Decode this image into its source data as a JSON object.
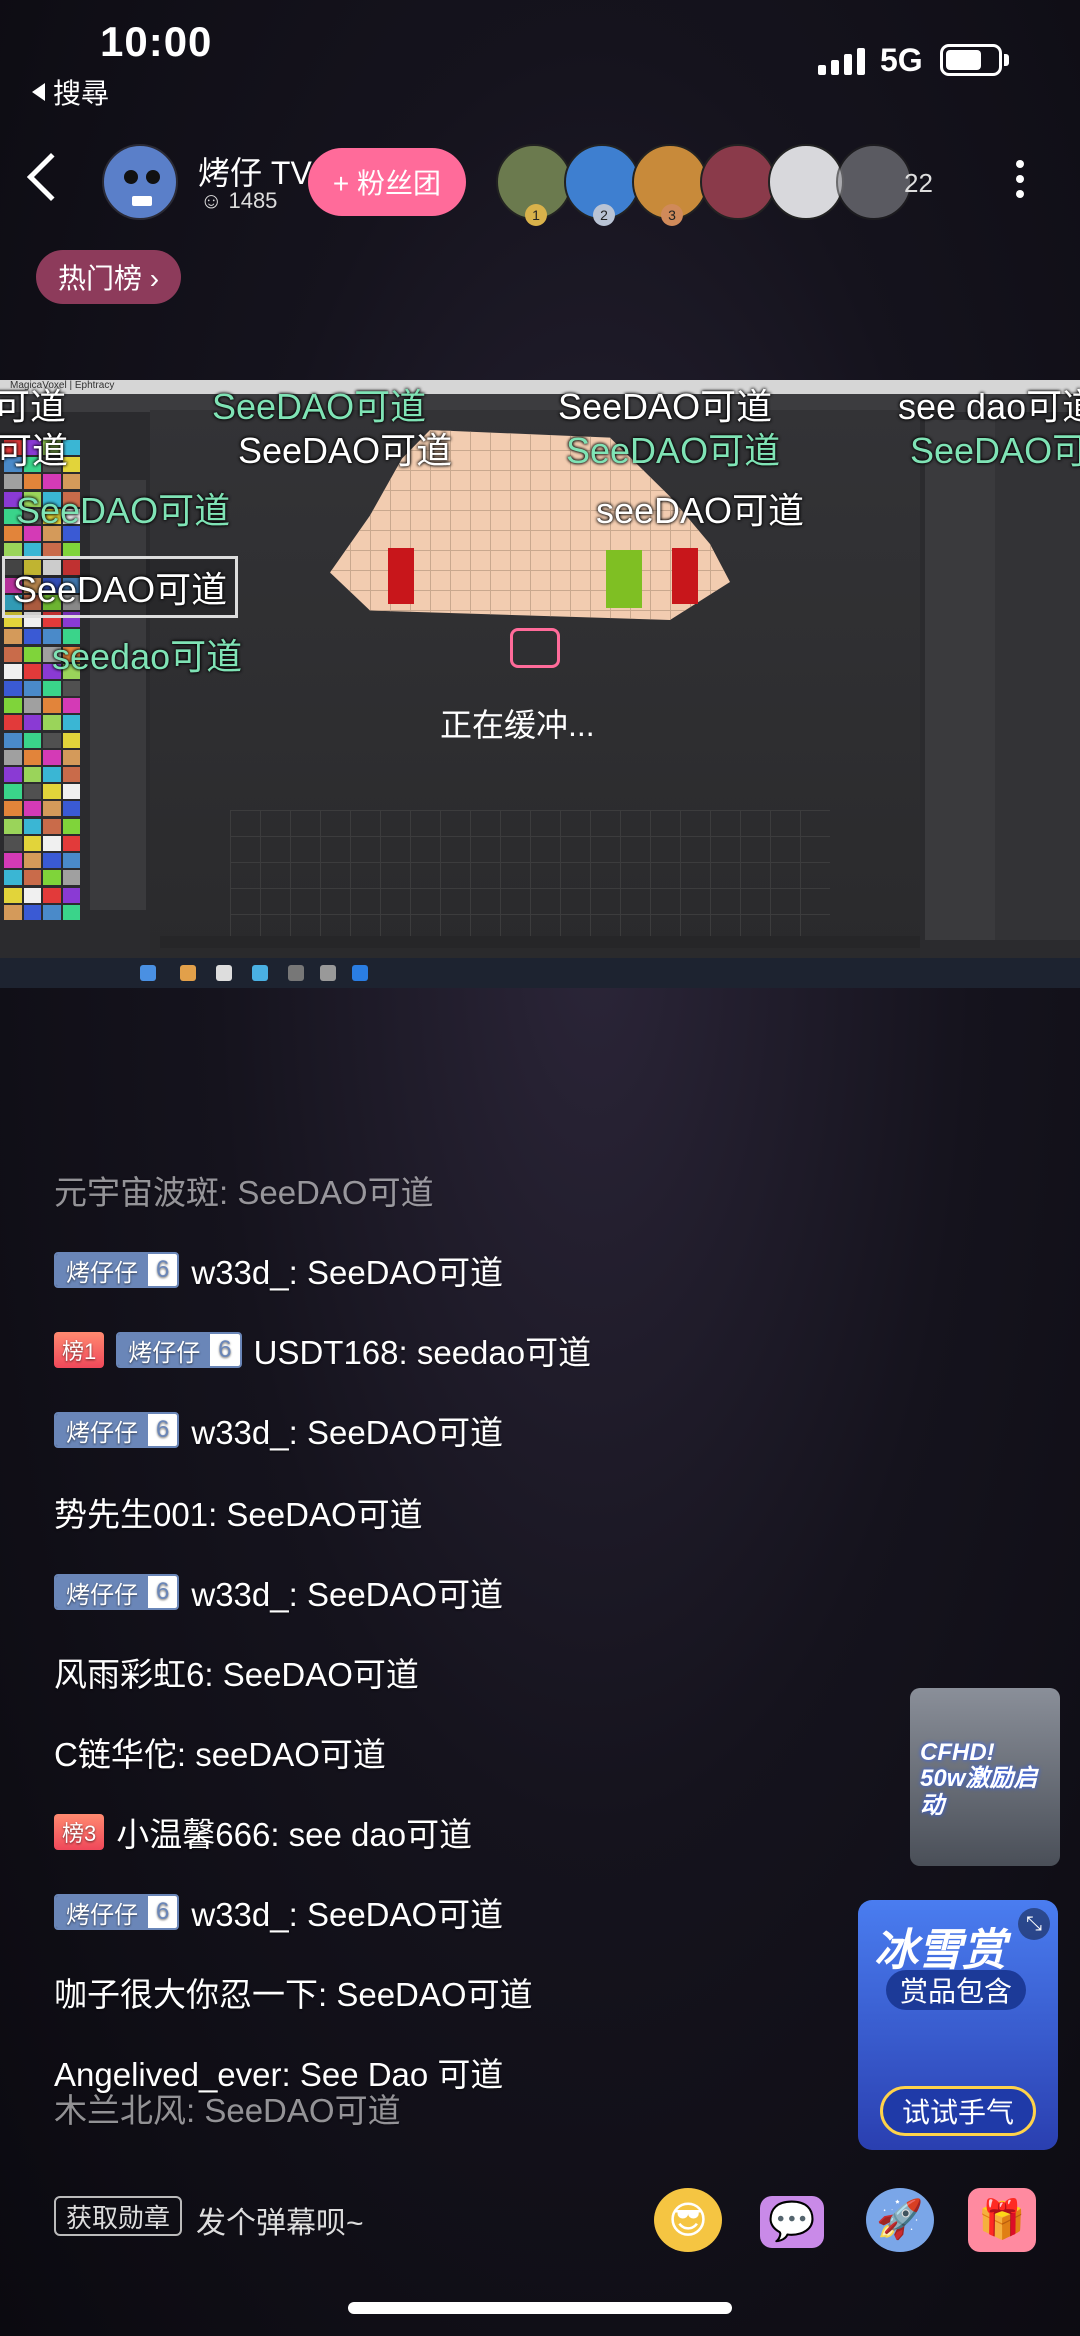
{
  "status_bar": {
    "time": "10:00",
    "back_app": "搜尋",
    "network": "5G"
  },
  "header": {
    "host_name": "烤仔 TV",
    "fan_count": "1485",
    "fan_club_label": "+ 粉丝团",
    "viewer_count": "22",
    "hot_tag": "热门榜 ›",
    "viewer_ranks": [
      "1",
      "2",
      "3"
    ]
  },
  "video": {
    "app_title": "MagicaVoxel | Ephtracy",
    "status": "正在缓冲...",
    "danmaku": [
      "可道",
      "SeeDAO可道",
      "SeeDAO可道",
      "see dao可道",
      "SeeDAO可道",
      "SeeDAO可道",
      "SeeDAO可",
      "可道",
      "SeeDAO可道",
      "seeDAO可道",
      "SeeDAO可道",
      "seedao可道"
    ]
  },
  "chat": [
    {
      "name": "元宇宙波斑",
      "message": "SeeDAO可道",
      "faded": true
    },
    {
      "medal": "烤仔仔",
      "level": "6",
      "name": "w33d_",
      "message": "SeeDAO可道"
    },
    {
      "rank": "榜1",
      "medal": "烤仔仔",
      "level": "6",
      "name": "USDT168",
      "message": "seedao可道"
    },
    {
      "medal": "烤仔仔",
      "level": "6",
      "name": "w33d_",
      "message": "SeeDAO可道"
    },
    {
      "name": "势先生001",
      "message": "SeeDAO可道"
    },
    {
      "medal": "烤仔仔",
      "level": "6",
      "name": "w33d_",
      "message": "SeeDAO可道"
    },
    {
      "name": "风雨彩虹6",
      "message": "SeeDAO可道"
    },
    {
      "name": "C链华佗",
      "message": "seeDAO可道"
    },
    {
      "rank": "榜3",
      "name": "小温馨666",
      "message": "see dao可道"
    },
    {
      "medal": "烤仔仔",
      "level": "6",
      "name": "w33d_",
      "message": "SeeDAO可道"
    },
    {
      "name": "咖子很大你忍一下",
      "message": "SeeDAO可道"
    },
    {
      "name": "Angelived_ever",
      "message": "See Dao 可道"
    },
    {
      "name": "木兰北风",
      "message": "SeeDAO可道",
      "faded": true
    }
  ],
  "ads": {
    "promo1": "CFHD!\n50w激励启动",
    "promo2_title": "冰雪赏",
    "promo2_sub": "赏品包含",
    "promo2_button": "试试手气"
  },
  "bottom_bar": {
    "medal_button": "获取勋章",
    "comment_placeholder": "发个弹幕呗~"
  },
  "colors": {
    "accent_pink": "#ff6b9a",
    "medal_blue": "#6a86b8",
    "danmaku_green": "#7fe3b5"
  }
}
